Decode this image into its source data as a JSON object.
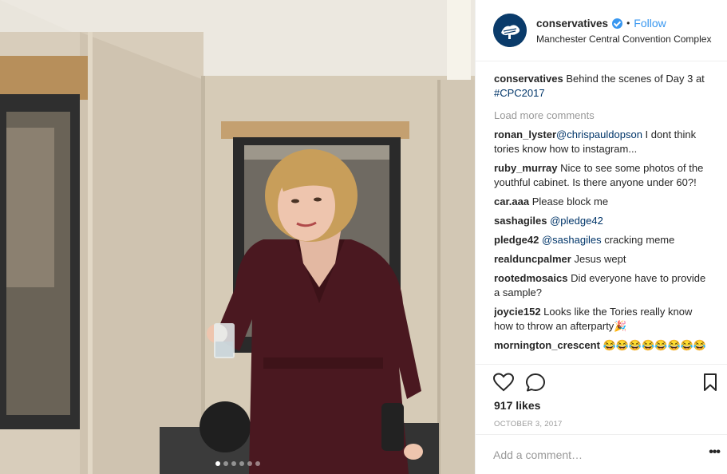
{
  "post": {
    "username": "conservatives",
    "follow_label": "Follow",
    "separator": "•",
    "location": "Manchester Central Convention Complex",
    "caption_user": "conservatives",
    "caption_text": " Behind the scenes of Day 3 at ",
    "caption_tag": "#CPC2017",
    "load_more": "Load more comments",
    "likes": "917 likes",
    "date": "OCTOBER 3, 2017",
    "add_comment_placeholder": "Add a comment…",
    "more_options": "•••",
    "carousel_count": 6,
    "carousel_active": 1
  },
  "comments": [
    {
      "user": "ronan_lyster",
      "mention": "@chrispauldopson",
      "text": " I dont think tories know how to instagram..."
    },
    {
      "user": "ruby_murray",
      "mention": "",
      "text": " Nice to see some photos of the youthful cabinet. Is there anyone under 60?!"
    },
    {
      "user": "car.aaa",
      "mention": "",
      "text": " Please block me"
    },
    {
      "user": "sashagiles",
      "mention": " @pledge42",
      "text": ""
    },
    {
      "user": "pledge42",
      "mention": " @sashagiles",
      "text": " cracking meme"
    },
    {
      "user": "realduncpalmer",
      "mention": "",
      "text": " Jesus wept"
    },
    {
      "user": "rootedmosaics",
      "mention": "",
      "text": " Did everyone have to provide a sample?"
    },
    {
      "user": "joycie152",
      "mention": "",
      "text": " Looks like the Tories really know how to throw an afterparty🎉"
    },
    {
      "user": "mornington_crescent",
      "mention": "",
      "text": " 😂😂😂😂😂😂😂😂"
    }
  ],
  "icons": {
    "heart": "heart-icon",
    "comment": "comment-icon",
    "save": "bookmark-icon",
    "verified": "verified-badge-icon",
    "avatar": "conservatives-tree-logo"
  },
  "colors": {
    "link_blue": "#3897f0",
    "tag_blue": "#003569",
    "muted": "#999999",
    "dress": "#4a1820",
    "wall": "#cdc3b2"
  }
}
